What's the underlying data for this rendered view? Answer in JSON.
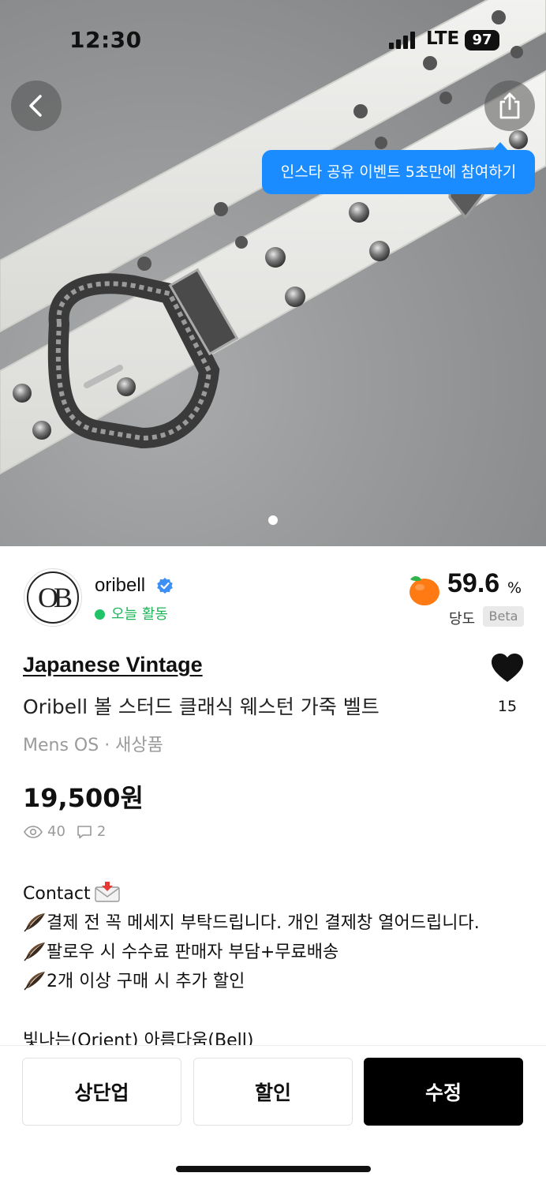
{
  "status_bar": {
    "time": "12:30",
    "network": "LTE",
    "battery": "97"
  },
  "hero": {
    "tooltip": "인스타 공유 이벤트 5초만에 참여하기",
    "carousel_dots": 1,
    "active_dot": 0
  },
  "seller": {
    "name": "oribell",
    "verified": true,
    "activity": "오늘 활동",
    "temperature_value": "59.6",
    "temperature_unit": "%",
    "temperature_label": "당도",
    "beta_badge": "Beta",
    "avatar_initials": "OB"
  },
  "product": {
    "brand": "Japanese Vintage",
    "title": "Oribell 볼 스터드 클래식 웨스턴 가죽 벨트",
    "meta": "Mens OS · 새상품",
    "price": "19,500원",
    "likes": "15",
    "views": "40",
    "chats": "2"
  },
  "description": {
    "contact": "Contact",
    "lines": [
      "결제 전 꼭 메세지 부탁드립니다. 개인 결제창 열어드립니다.",
      "팔로우 시 수수료 판매자 부담+무료배송",
      "2개 이상 구매 시 추가 할인"
    ],
    "cutoff_line": "빛나는(Orient) 아름다움(Bell)"
  },
  "actions": {
    "bump": "상단업",
    "discount": "할인",
    "edit": "수정"
  },
  "colors": {
    "accent_blue": "#1a8cff",
    "active_green": "#20c466",
    "primary_black": "#000000"
  },
  "icons": {
    "back": "chevron-left-icon",
    "share": "share-icon",
    "verified": "verified-badge-icon",
    "temperature": "peach-icon",
    "like": "heart-icon",
    "views": "eye-icon",
    "chats": "chat-bubble-icon",
    "feather": "feather-icon",
    "mail": "incoming-envelope-icon"
  }
}
